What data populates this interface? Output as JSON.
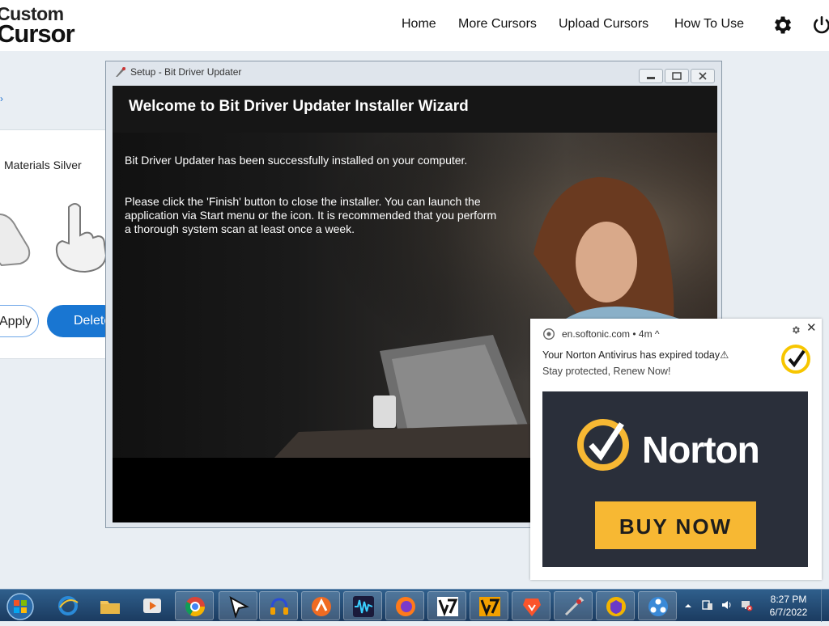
{
  "site": {
    "logo_line1": "Custom",
    "logo_line2": "Cursor",
    "nav": [
      "Home",
      "More Cursors",
      "Upload Cursors",
      "How To Use"
    ],
    "icons": [
      "gear-icon",
      "power-icon"
    ]
  },
  "background_card": {
    "title": "Materials Silver",
    "apply_label": "Apply",
    "delete_label": "Delete"
  },
  "setup_window": {
    "title": "Setup - Bit Driver Updater",
    "heading": "Welcome to Bit Driver Updater Installer Wizard",
    "paragraph1": "Bit Driver Updater has been successfully installed on your computer.",
    "paragraph2": "Please click the 'Finish' button to close the installer. You can launch the application via Start menu or the icon. It is recommended that you perform a thorough system scan at least once a week."
  },
  "notification": {
    "source": "en.softonic.com",
    "age": "4m",
    "title": "Your Norton Antivirus has expired today⚠",
    "body": "Stay protected, Renew Now!",
    "ad_brand": "Norton",
    "ad_cta": "BUY NOW",
    "colors": {
      "accent": "#f7b833",
      "ad_bg": "#2a2f3a"
    }
  },
  "taskbar": {
    "apps": [
      "internet-explorer-icon",
      "file-explorer-icon",
      "media-player-icon",
      "chrome-icon",
      "cursor-app-icon",
      "audio-app-icon",
      "avast-icon",
      "audio-wave-icon",
      "firefox-icon",
      "v7-app-icon",
      "v7-app-icon",
      "brave-icon",
      "tools-icon",
      "keeper-icon",
      "network-app-icon"
    ],
    "time": "8:27 PM",
    "date": "6/7/2022"
  }
}
